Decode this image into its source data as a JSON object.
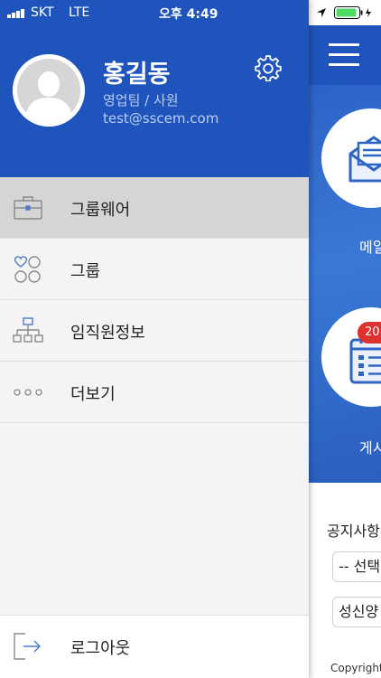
{
  "status_bar": {
    "carrier": "SKT",
    "network": "LTE",
    "time": "오후 4:49"
  },
  "profile": {
    "name": "홍길동",
    "department": "영업팀 / 사원",
    "email": "test@sscem.com",
    "avatar_icon": "user-avatar-icon",
    "settings_icon": "gear-icon"
  },
  "menu": {
    "items": [
      {
        "label": "그룹웨어",
        "icon": "briefcase-icon",
        "active": true
      },
      {
        "label": "그룹",
        "icon": "group-icon",
        "active": false
      },
      {
        "label": "임직원정보",
        "icon": "org-chart-icon",
        "active": false
      },
      {
        "label": "더보기",
        "icon": "more-dots-icon",
        "active": false
      }
    ],
    "logout_label": "로그아웃",
    "logout_icon": "logout-icon"
  },
  "background_app": {
    "tiles": [
      {
        "label": "메일",
        "icon": "mail-icon"
      },
      {
        "label": "게시",
        "icon": "board-icon",
        "badge": "20"
      }
    ],
    "notice_title": "공지사항",
    "select_1": "-- 선택",
    "select_2": "성신양",
    "copyright": "Copyright"
  },
  "colors": {
    "header_blue": "#2054bd",
    "menu_active": "#d5d5d5",
    "badge_red": "#e03131"
  }
}
